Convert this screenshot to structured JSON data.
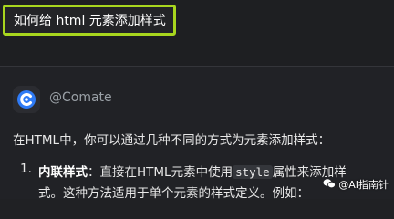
{
  "query": {
    "text": "如何给 html 元素添加样式"
  },
  "answer": {
    "author": "@Comate",
    "intro": "在HTML中，你可以通过几种不同的方式为元素添加样式：",
    "list_item_1": {
      "number": "1.",
      "title": "内联样式",
      "text_before_code": "：直接在HTML元素中使用",
      "code": "style",
      "text_after_code": "属性来添加样",
      "line2": "式。这种方法适用于单个元素的样式定义。例如："
    }
  },
  "watermark": {
    "text": "@AI指南针"
  },
  "icons": {
    "avatar": "comate-logo-icon",
    "watermark": "wechat-icon"
  },
  "colors": {
    "highlight_border": "#a8d61e",
    "logo_blue": "#2f7bf6"
  }
}
